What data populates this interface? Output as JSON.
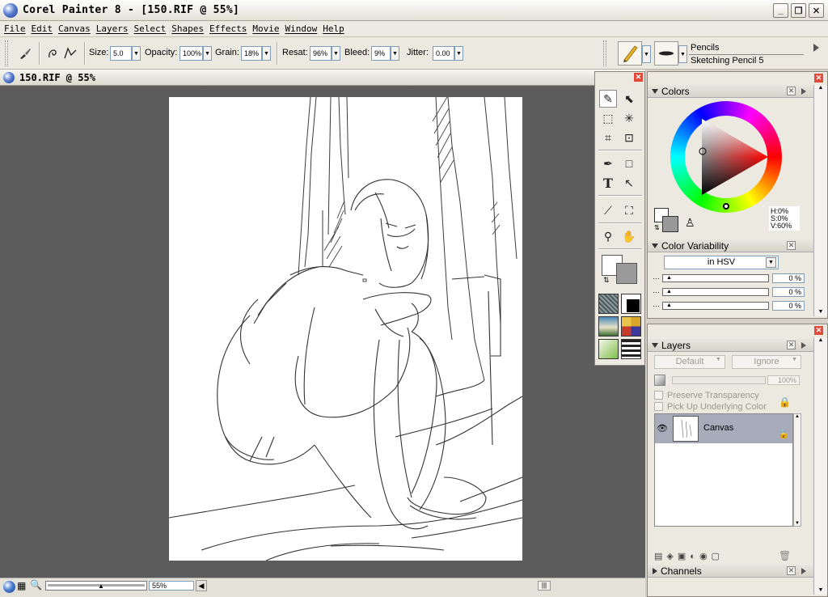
{
  "window": {
    "title": "Corel Painter 8 - [150.RIF @ 55%]",
    "min_label": "_",
    "max_label": "❐",
    "close_label": "✕"
  },
  "menu": [
    "File",
    "Edit",
    "Canvas",
    "Layers",
    "Select",
    "Shapes",
    "Effects",
    "Movie",
    "Window",
    "Help"
  ],
  "property_bar": {
    "size_label": "Size:",
    "size_value": "5.0",
    "opacity_label": "Opacity:",
    "opacity_value": "100%",
    "grain_label": "Grain:",
    "grain_value": "18%",
    "resat_label": "Resat:",
    "resat_value": "96%",
    "bleed_label": "Bleed:",
    "bleed_value": "9%",
    "jitter_label": "Jitter:",
    "jitter_value": "0.00"
  },
  "brush_selector": {
    "category": "Pencils",
    "variant": "Sketching Pencil 5"
  },
  "document": {
    "title": "150.RIF @ 55%"
  },
  "status": {
    "zoom": "55%"
  },
  "colors_panel": {
    "title": "Colors",
    "h": "H:0%",
    "s": "S:0%",
    "v": "V:60%"
  },
  "variability_panel": {
    "title": "Color Variability",
    "mode": "in HSV",
    "v1": "0 %",
    "v2": "0 %",
    "v3": "0 %"
  },
  "layers_panel": {
    "title": "Layers",
    "composite_method": "Default",
    "depth": "Ignore",
    "opacity": "100%",
    "preserve_transparency": "Preserve Transparency",
    "pick_up": "Pick Up Underlying Color",
    "layer_name": "Canvas"
  },
  "channels_panel": {
    "title": "Channels"
  },
  "colors": {
    "main": "#ffffff",
    "additional": "#999999"
  }
}
